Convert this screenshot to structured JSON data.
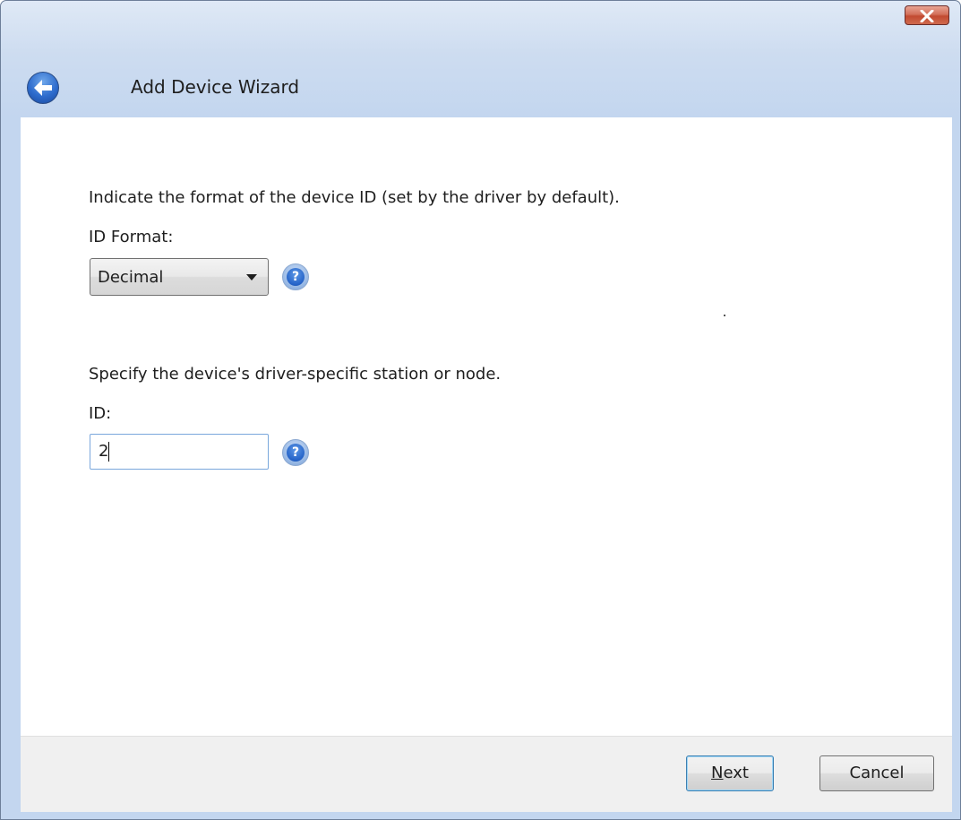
{
  "window": {
    "title": "Add Device Wizard",
    "close_icon": "close-icon",
    "back_icon": "back-arrow-icon"
  },
  "form": {
    "format_prompt": "Indicate the format of the device ID (set by the driver by default).",
    "format_label": "ID Format:",
    "format_value": "Decimal",
    "id_prompt": "Specify the device's driver-specific station or node.",
    "id_label": "ID:",
    "id_value": "2",
    "help_glyph": "?"
  },
  "footer": {
    "next_label": "Next",
    "cancel_label": "Cancel"
  },
  "colors": {
    "accent": "#2e6ccd",
    "close_red": "#c24a31",
    "frame": "#c3d6ef"
  }
}
